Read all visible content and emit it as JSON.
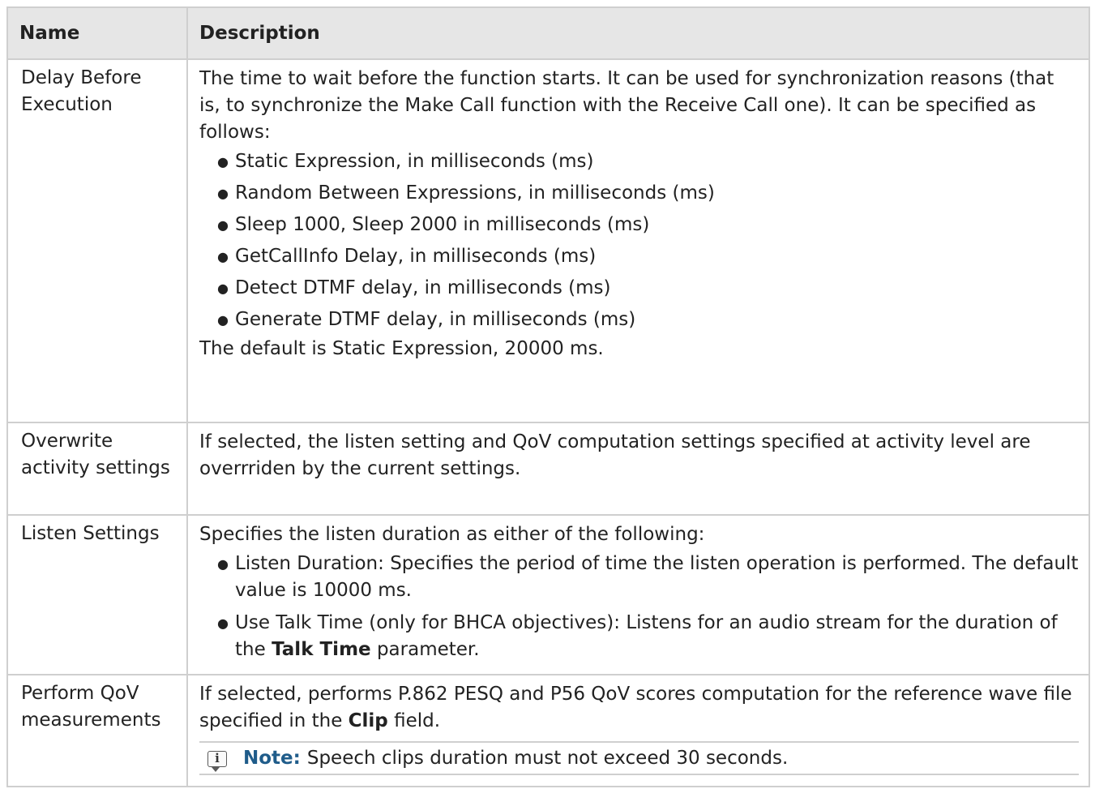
{
  "table": {
    "headers": {
      "name": "Name",
      "description": "Description"
    },
    "rows": {
      "delay": {
        "name": "Delay Before Execution",
        "intro": "The time to wait before the function starts. It can be used for synchronization reasons (that is, to synchronize the Make Call function with the Receive Call one). It can be specified as follows:",
        "bullets": [
          "Static Expression, in milliseconds (ms)",
          "Random Between Expressions, in milliseconds (ms)",
          "Sleep 1000, Sleep 2000 in milliseconds (ms)",
          "GetCallInfo Delay, in milliseconds (ms)",
          "Detect DTMF delay, in milliseconds (ms)",
          "Generate DTMF delay, in milliseconds (ms)"
        ],
        "outro": "The default is Static Expression, 20000 ms."
      },
      "overwrite": {
        "name": "Overwrite activity settings",
        "description": "If selected, the listen setting and QoV computation settings specified at activity level are overrriden by the current settings."
      },
      "listen": {
        "name": "Listen Settings",
        "intro": "Specifies the listen duration as either of the following:",
        "bullet1": "Listen Duration: Specifies the period of time the listen operation is performed. The default value is 10000 ms.",
        "bullet2_prefix": "Use Talk Time (only for BHCA objectives): Listens for an audio stream for the duration of the ",
        "bullet2_bold": "Talk Time",
        "bullet2_suffix": " parameter."
      },
      "qov": {
        "name": "Perform QoV measurements",
        "desc_prefix": "If selected, performs P.862 PESQ and P56 QoV scores computation for the reference wave file specified in the ",
        "desc_bold": "Clip",
        "desc_suffix": " field.",
        "note_label": "Note:",
        "note_text": "Speech clips duration must not exceed 30 seconds.",
        "note_icon": "info-icon"
      }
    }
  },
  "colors": {
    "header_bg": "#e6e6e6",
    "border": "#cfcfcf",
    "note_label": "#1f5c8a",
    "text": "#222222"
  }
}
